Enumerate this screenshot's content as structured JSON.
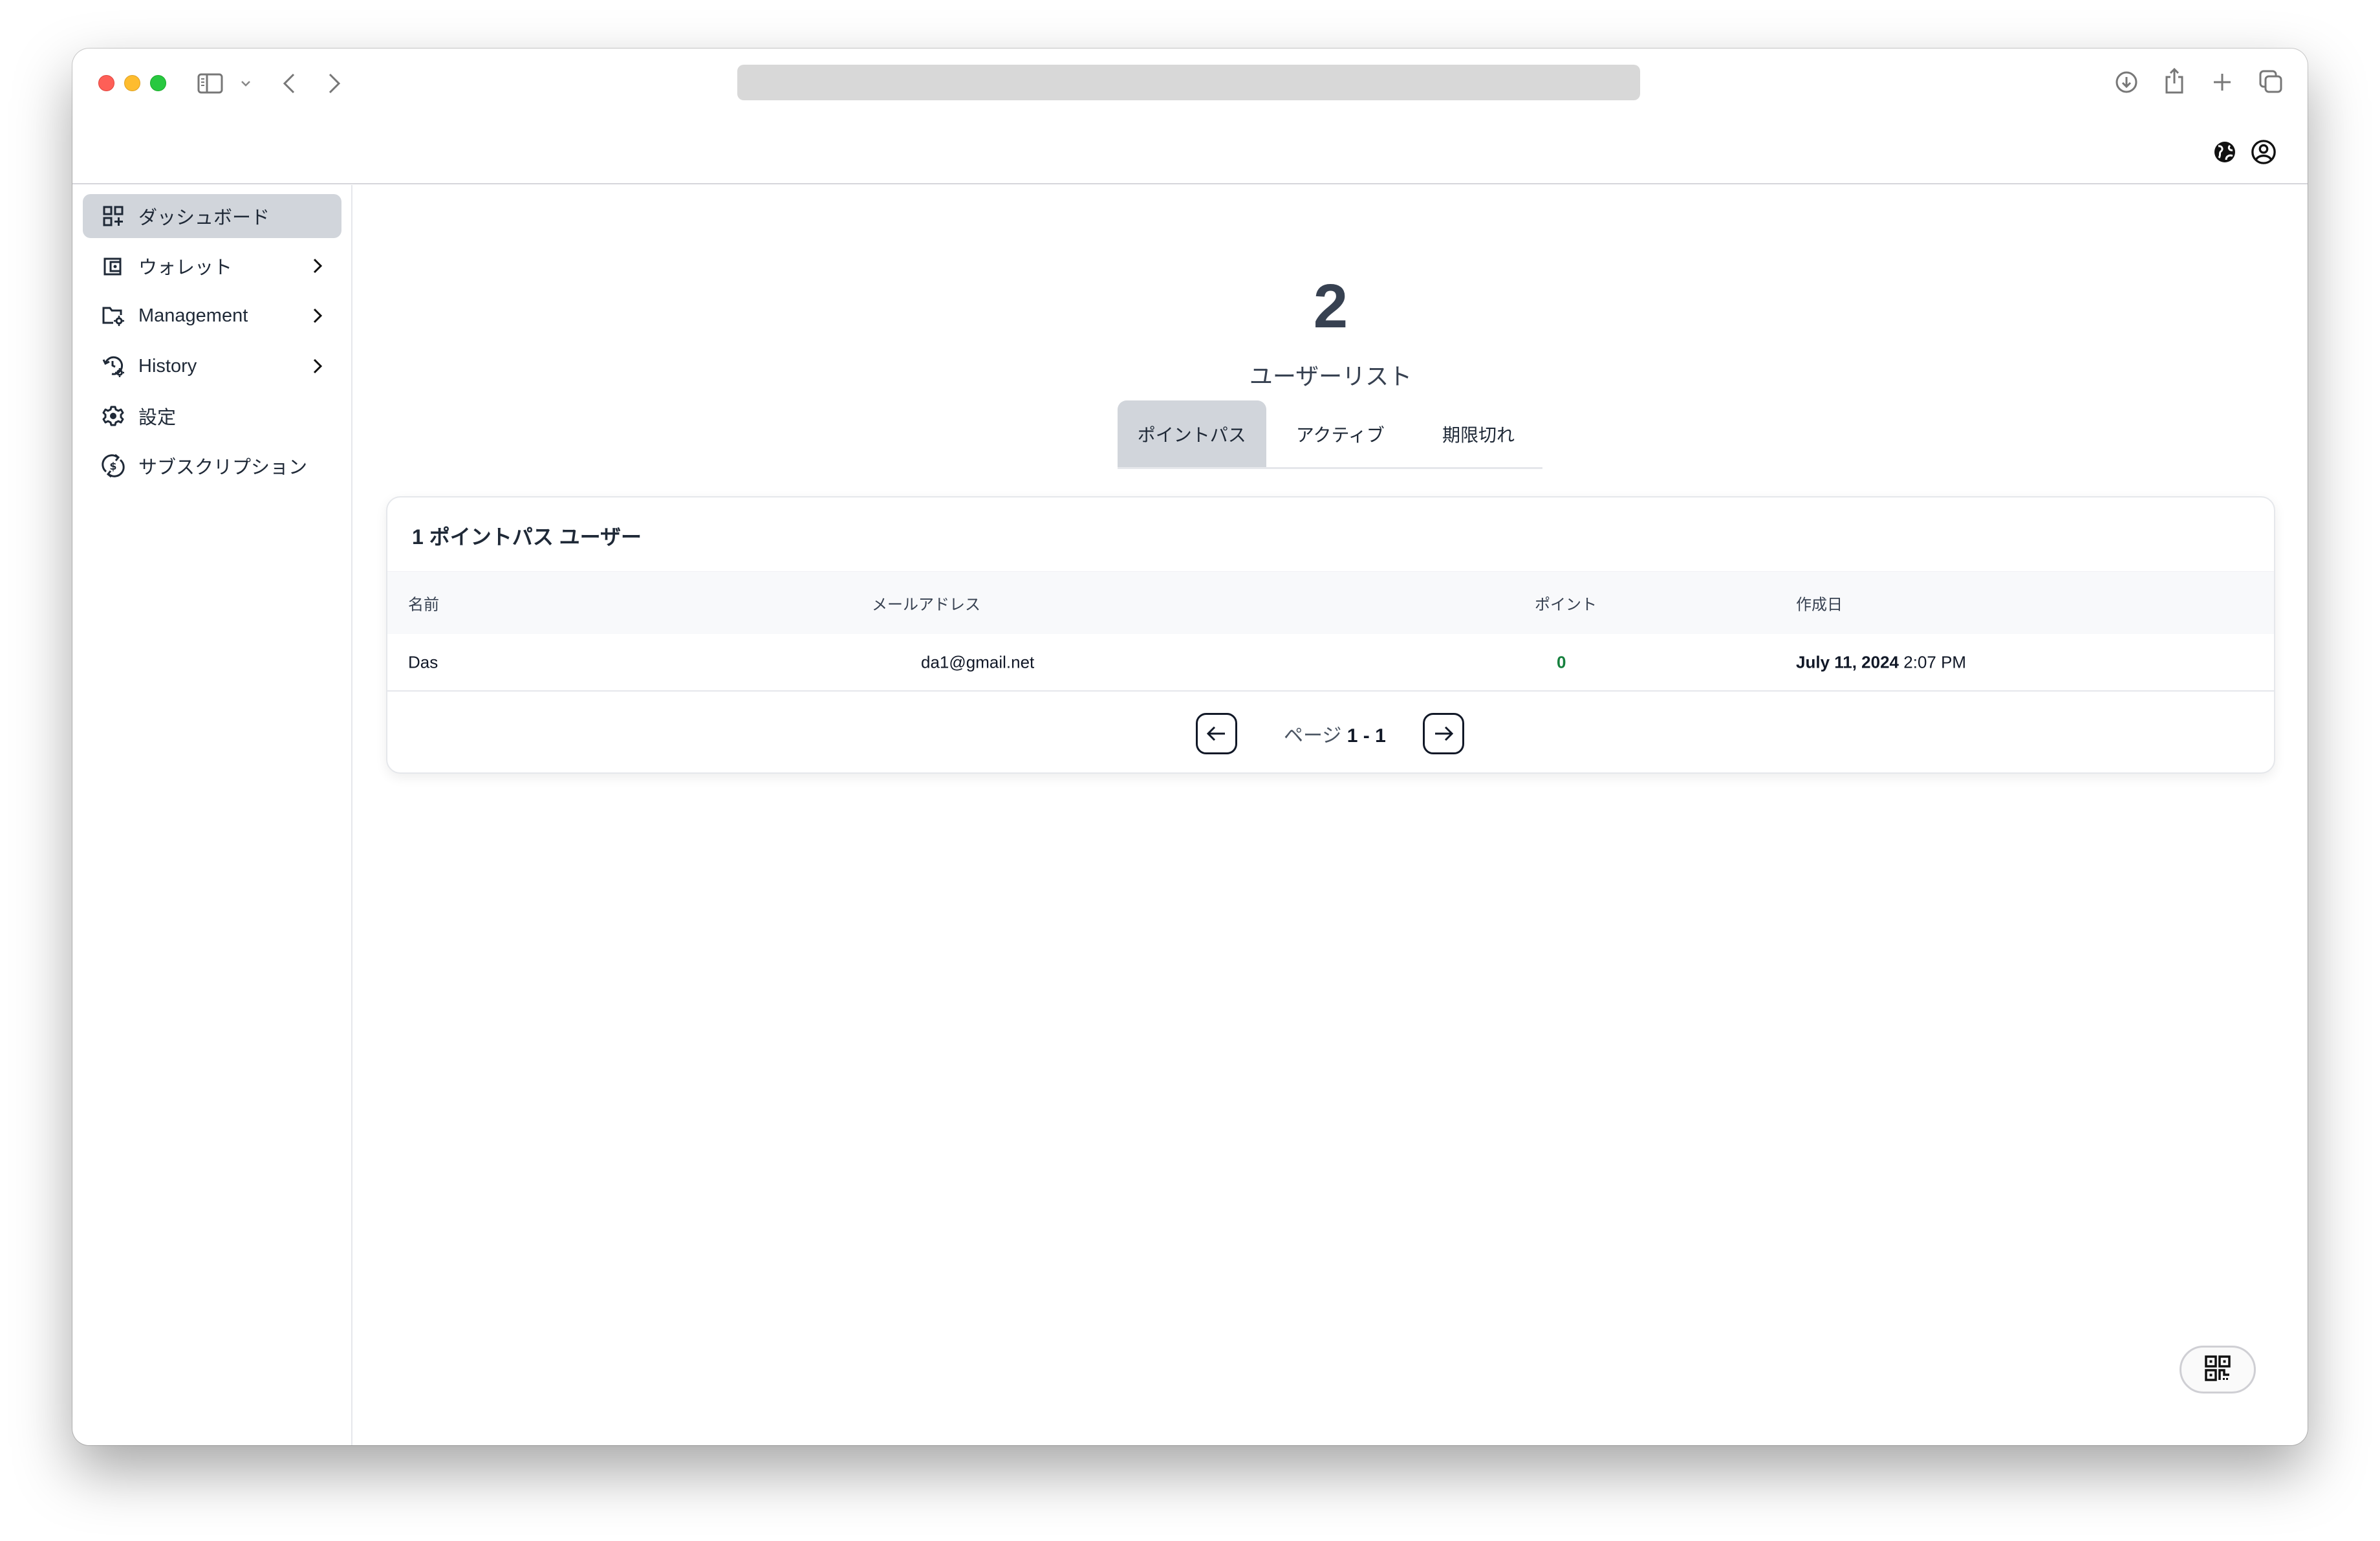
{
  "browser": {
    "toolbar_icons": [
      "sidebar-toggle-icon",
      "chevron-down-icon",
      "back-icon",
      "forward-icon",
      "download-icon",
      "share-icon",
      "new-tab-icon",
      "tab-overview-icon"
    ],
    "address_bar_value": ""
  },
  "header": {
    "icons": [
      "globe-icon",
      "user-account-icon"
    ]
  },
  "sidebar": {
    "items": [
      {
        "label": "ダッシュボード",
        "icon": "dashboard-icon",
        "active": true,
        "has_chevron": false
      },
      {
        "label": "ウォレット",
        "icon": "wallet-icon",
        "active": false,
        "has_chevron": true
      },
      {
        "label": "Management",
        "icon": "folder-settings-icon",
        "active": false,
        "has_chevron": true
      },
      {
        "label": "History",
        "icon": "history-settings-icon",
        "active": false,
        "has_chevron": true
      },
      {
        "label": "設定",
        "icon": "gear-icon",
        "active": false,
        "has_chevron": false
      },
      {
        "label": "サブスクリプション",
        "icon": "subscription-icon",
        "active": false,
        "has_chevron": false
      }
    ]
  },
  "main": {
    "stat_number": "2",
    "stat_label": "ユーザーリスト",
    "tabs": [
      {
        "label": "ポイントパス",
        "active": true
      },
      {
        "label": "アクティブ",
        "active": false
      },
      {
        "label": "期限切れ",
        "active": false
      }
    ],
    "card": {
      "title": "1 ポイントパス ユーザー",
      "columns": [
        "名前",
        "メールアドレス",
        "ポイント",
        "作成日"
      ],
      "rows": [
        {
          "name": "Das",
          "email": "da1@gmail.net",
          "points": "0",
          "created_date": "July 11, 2024",
          "created_time": "2:07 PM"
        }
      ],
      "pagination": {
        "prefix": "ページ",
        "range": "1 - 1"
      }
    },
    "qr_button_icon": "qr-code-icon"
  },
  "colors": {
    "active_bg": "#d1d5db",
    "points_green": "#15803d",
    "text_dark": "#1f2937"
  }
}
